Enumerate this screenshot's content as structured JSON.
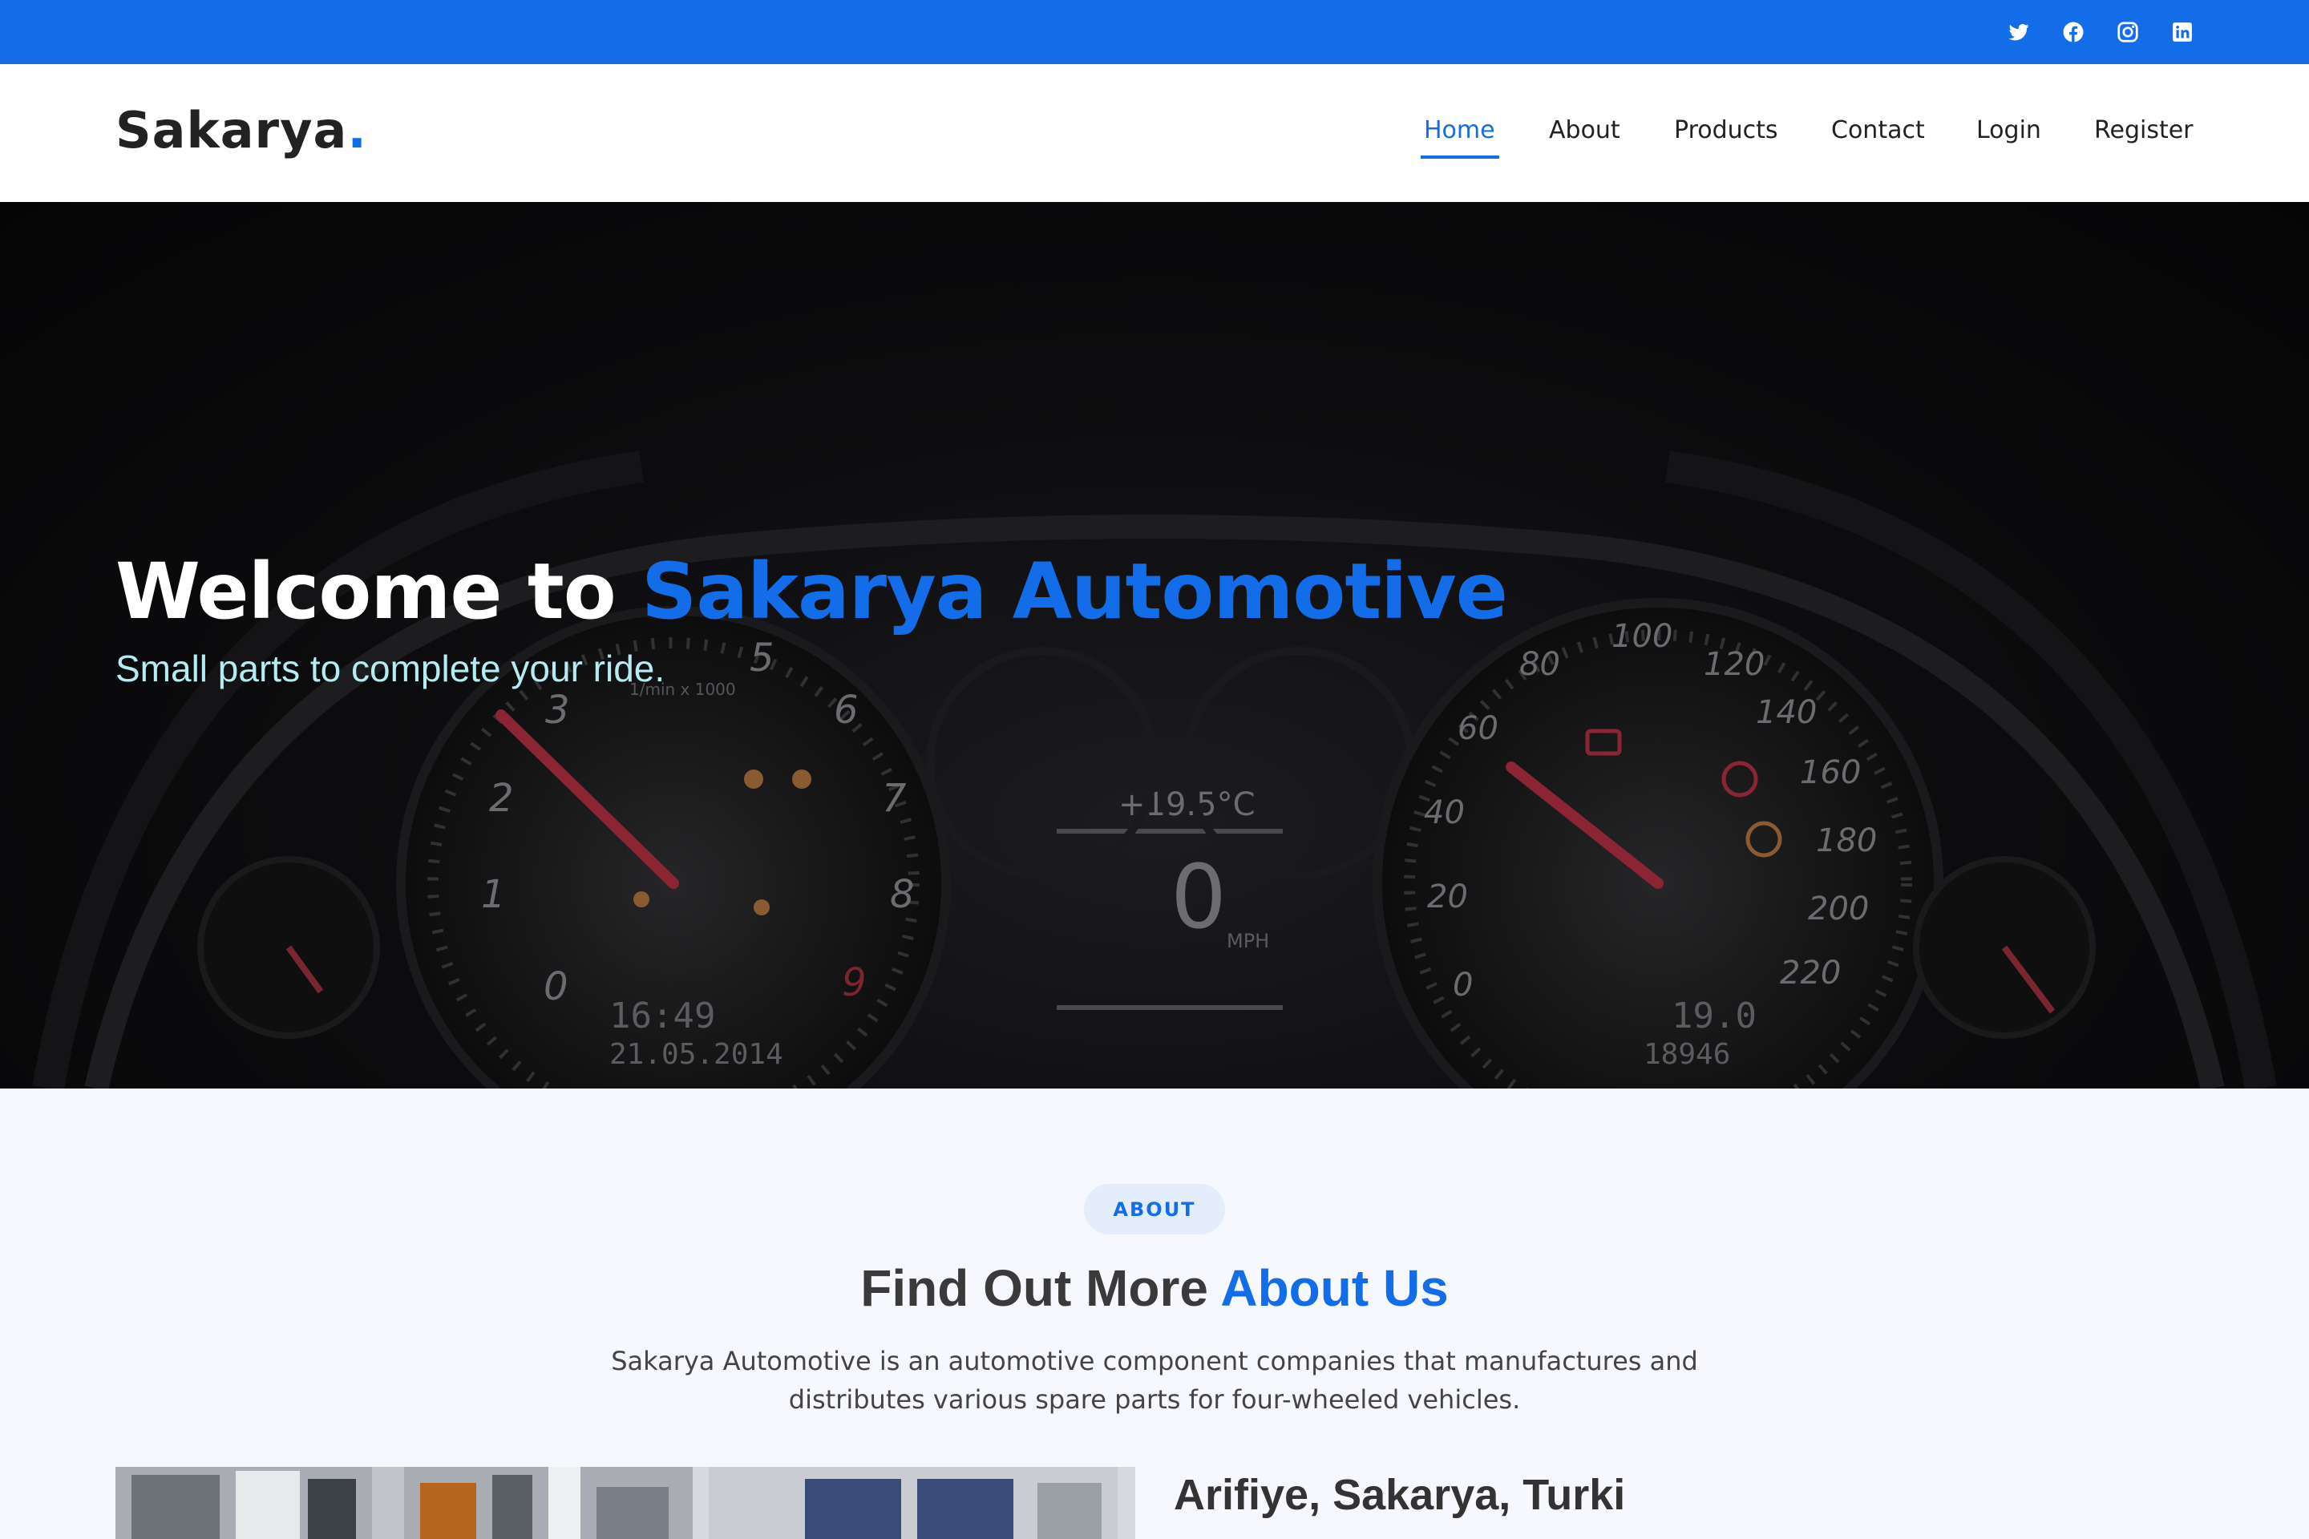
{
  "topbar": {
    "social": [
      "twitter-icon",
      "facebook-icon",
      "instagram-icon",
      "linkedin-icon"
    ],
    "color": "#136ce8"
  },
  "header": {
    "logo": "Sakarya",
    "logo_dot": ".",
    "nav": {
      "home": "Home",
      "about": "About",
      "products": "Products",
      "contact": "Contact",
      "login": "Login",
      "register": "Register"
    },
    "active": "Home"
  },
  "hero": {
    "title_prefix": "Welcome to ",
    "title_accent": "Sakarya Automotive",
    "subtitle": "Small parts to complete your ride.",
    "dash": {
      "temp": "+19.5°C",
      "speed": "0",
      "speed_unit": "MPH",
      "time": "16:49",
      "date": "21.05.2014",
      "trip": "19.0",
      "odometer": "18946",
      "rpm_ticks": [
        "0",
        "1",
        "2",
        "3",
        "5",
        "6",
        "7",
        "8",
        "9"
      ],
      "rpm_unit": "1/min x 1000",
      "speed_ticks": [
        "20",
        "40",
        "60",
        "80",
        "100",
        "120",
        "140",
        "160",
        "180",
        "200",
        "220"
      ]
    }
  },
  "about": {
    "badge": "ABOUT",
    "title_prefix": "Find Out More ",
    "title_accent": "About Us",
    "description": "Sakarya Automotive is an automotive component companies that manufactures and distributes various spare parts for four-wheeled vehicles.",
    "location": "Arifiye, Sakarya, Turki"
  },
  "colors": {
    "accent": "#136ce8",
    "subtitle": "#b3ecf3",
    "section_bg": "#f6f8fd"
  }
}
